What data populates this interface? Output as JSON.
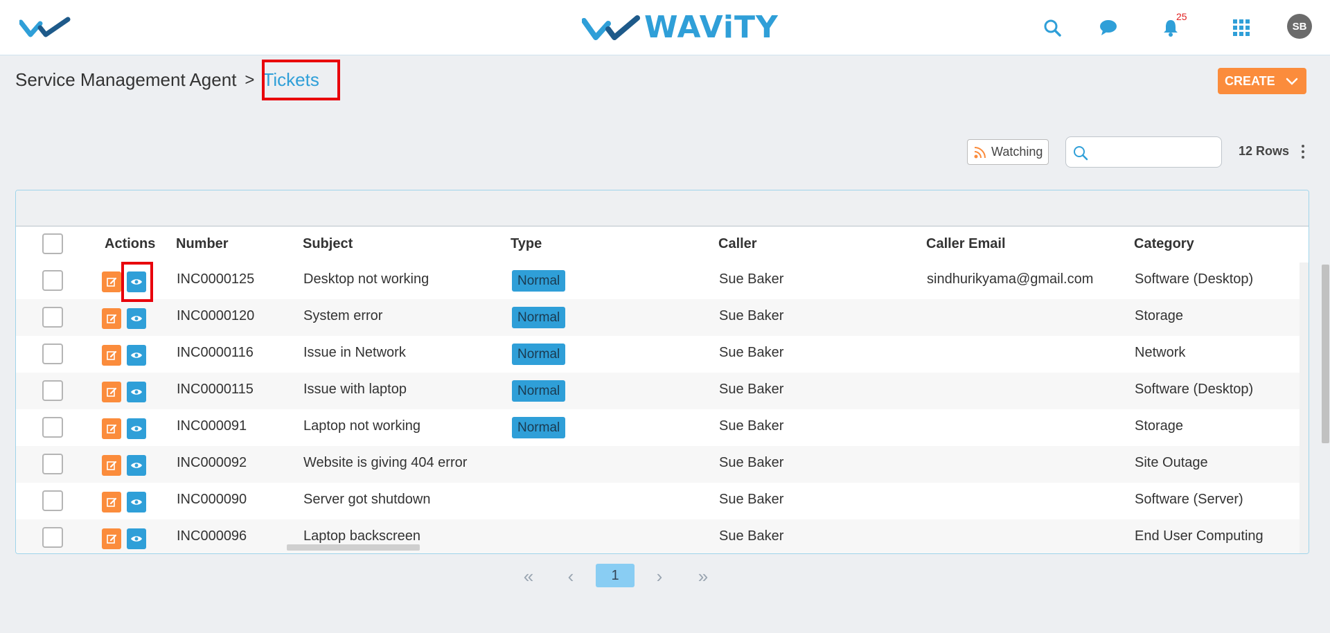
{
  "app": {
    "brand_name": "WAViTY",
    "brand_color": "#2f9fd8",
    "accent_color": "#fb8c3c",
    "notification_count": "25",
    "user_initials": "SB",
    "icons": [
      "search-icon",
      "chat-icon",
      "bell-icon",
      "apps-grid-icon"
    ]
  },
  "breadcrumb": {
    "parent": "Service Management Agent",
    "separator": ">",
    "current": "Tickets"
  },
  "toolbar": {
    "create_label": "CREATE",
    "watching_label": "Watching",
    "search_placeholder": "",
    "rows_label": "12 Rows"
  },
  "table": {
    "columns": [
      "Actions",
      "Number",
      "Subject",
      "Type",
      "Caller",
      "Caller Email",
      "Category"
    ],
    "rows": [
      {
        "number": "INC0000125",
        "subject": "Desktop not working",
        "type": "Normal",
        "caller": "Sue Baker",
        "email": "sindhurikyama@gmail.com",
        "category": "Software (Desktop)"
      },
      {
        "number": "INC0000120",
        "subject": "System error",
        "type": "Normal",
        "caller": "Sue Baker",
        "email": "",
        "category": "Storage"
      },
      {
        "number": "INC0000116",
        "subject": "Issue in Network",
        "type": "Normal",
        "caller": "Sue Baker",
        "email": "",
        "category": "Network"
      },
      {
        "number": "INC0000115",
        "subject": "Issue with laptop",
        "type": "Normal",
        "caller": "Sue Baker",
        "email": "",
        "category": "Software (Desktop)"
      },
      {
        "number": "INC000091",
        "subject": "Laptop not working",
        "type": "Normal",
        "caller": "Sue Baker",
        "email": "",
        "category": "Storage"
      },
      {
        "number": "INC000092",
        "subject": "Website is giving 404 error",
        "type": "",
        "caller": "Sue Baker",
        "email": "",
        "category": "Site Outage"
      },
      {
        "number": "INC000090",
        "subject": "Server got shutdown",
        "type": "",
        "caller": "Sue Baker",
        "email": "",
        "category": "Software (Server)"
      },
      {
        "number": "INC000096",
        "subject": "Laptop backscreen",
        "type": "",
        "caller": "Sue Baker",
        "email": "",
        "category": "End User Computing"
      }
    ]
  },
  "pagination": {
    "first": "«",
    "prev": "‹",
    "current_page": "1",
    "next": "›",
    "last": "»"
  }
}
